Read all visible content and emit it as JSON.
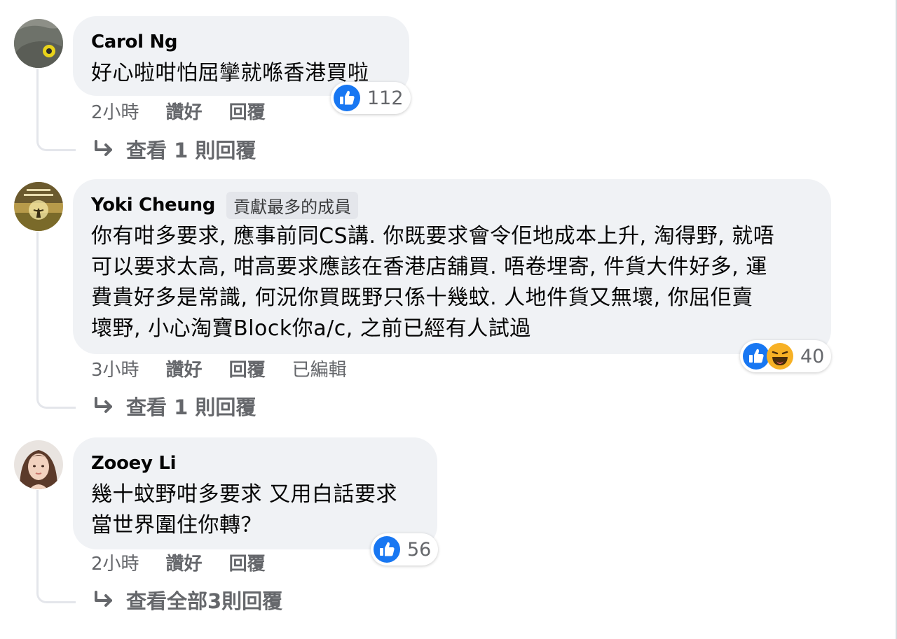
{
  "comments": [
    {
      "author": "Carol Ng",
      "text_lines": [
        "好心啦咁怕屈攣就喺香港買啦"
      ],
      "reaction_count": "112",
      "reaction_icons": [
        "like-icon"
      ],
      "time": "2小時",
      "like_label": "讚好",
      "reply_label": "回覆",
      "view_replies": "查看 1 則回覆"
    },
    {
      "author": "Yoki Cheung",
      "badge": "貢獻最多的成員",
      "text_lines": [
        "你有咁多要求, 應事前同CS講. 你既要求會令佢地成本上升, 淘得野, 就唔",
        "可以要求太高, 咁高要求應該在香港店舖買. 唔卷埋寄, 件貨大件好多, 運",
        "費貴好多是常識, 何況你買既野只係十幾蚊. 人地件貨又無壞, 你屈佢賣",
        "壞野, 小心淘寶Block你a/c, 之前已經有人試過"
      ],
      "reaction_count": "40",
      "reaction_icons": [
        "like-icon",
        "haha-icon"
      ],
      "time": "3小時",
      "like_label": "讚好",
      "reply_label": "回覆",
      "edited_label": "已編輯",
      "view_replies": "查看 1 則回覆"
    },
    {
      "author": "Zooey Li",
      "text_lines": [
        "幾十蚊野咁多要求 又用白話要求",
        "當世界圍住你轉？"
      ],
      "reaction_count": "56",
      "reaction_icons": [
        "like-icon"
      ],
      "time": "2小時",
      "like_label": "讚好",
      "reply_label": "回覆",
      "view_replies": "查看全部3則回覆"
    }
  ],
  "colors": {
    "bubble_bg": "#f0f2f5",
    "meta_text": "#65676b",
    "like_blue": "#1877f2",
    "haha_yellow": "#f7b125"
  }
}
